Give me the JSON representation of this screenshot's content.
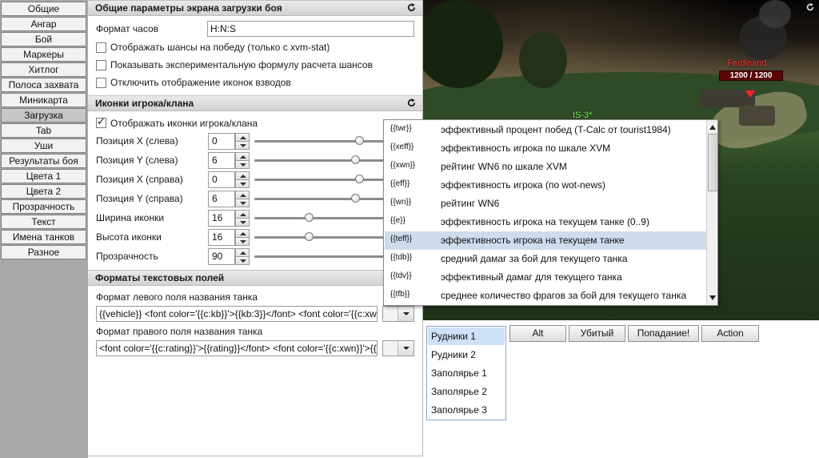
{
  "tabs": [
    "Общие",
    "Ангар",
    "Бой",
    "Маркеры",
    "Хитлог",
    "Полоса захвата",
    "Миникарта",
    "Загрузка",
    "Tab",
    "Уши",
    "Результаты боя",
    "Цвета 1",
    "Цвета 2",
    "Прозрачность",
    "Текст",
    "Имена танков",
    "Разное"
  ],
  "active_tab": "Загрузка",
  "section1": {
    "title": "Общие параметры экрана загрузки боя",
    "clock_label": "Формат часов",
    "clock_value": "H:N:S",
    "checks": [
      {
        "label": "Отображать шансы на победу (только с xvm-stat)",
        "checked": false
      },
      {
        "label": "Показывать экспериментальную формулу расчета шансов",
        "checked": false
      },
      {
        "label": "Отключить отображение иконок взводов",
        "checked": false
      }
    ]
  },
  "section2": {
    "title": "Иконки игрока/клана",
    "check_label": "Отображать иконки игрока/клана",
    "check_on": true,
    "rows": [
      {
        "label": "Позиция X (слева)",
        "value": "0",
        "level": 0.5
      },
      {
        "label": "Позиция Y (слева)",
        "value": "6",
        "level": 0.48
      },
      {
        "label": "Позиция X (справа)",
        "value": "0",
        "level": 0.5
      },
      {
        "label": "Позиция Y (справа)",
        "value": "6",
        "level": 0.48
      },
      {
        "label": "Ширина иконки",
        "value": "16",
        "level": 0.26
      },
      {
        "label": "Высота иконки",
        "value": "16",
        "level": 0.26
      },
      {
        "label": "Прозрачность",
        "value": "90",
        "level": 0.9
      }
    ]
  },
  "section3": {
    "title": "Форматы текстовых полей",
    "left_label": "Формат левого поля названия танка",
    "left_value": "{{vehicle}} <font color='{{c:kb}}'>{{kb:3}}</font> <font color='{{c:xw",
    "right_label": "Формат правого поля названия танка",
    "right_value": "<font color='{{c:rating}}'>{{rating}}</font> <font color='{{c:xwn}}'>{{"
  },
  "game": {
    "enemy_name": "Ferdinand",
    "enemy_hp": "1200 / 1200",
    "ally_name": "IS-3*"
  },
  "macro_list": [
    {
      "code": "{{twr}}",
      "desc": "эффективный процент побед (T-Calc от tourist1984)"
    },
    {
      "code": "{{xeff}}",
      "desc": "эффективность игрока по шкале XVM"
    },
    {
      "code": "{{xwn}}",
      "desc": "рейтинг WN6 по шкале XVM"
    },
    {
      "code": "{{eff}}",
      "desc": "эффективность игрока (по wot-news)"
    },
    {
      "code": "{{wn}}",
      "desc": "рейтинг WN6"
    },
    {
      "code": "{{e}}",
      "desc": "эффективность игрока на текущем танке (0..9)"
    },
    {
      "code": "{{teff}}",
      "desc": "эффективность игрока на текущем танке"
    },
    {
      "code": "{{tdb}}",
      "desc": "средний дамаг за бой для текущего танка"
    },
    {
      "code": "{{tdv}}",
      "desc": "эффективный дамаг для текущего танка"
    },
    {
      "code": "{{tfb}}",
      "desc": "среднее количество фрагов за бой для текущего танка"
    }
  ],
  "macro_selected": 6,
  "maps": [
    "Рудники 1",
    "Рудники 2",
    "Заполярье 1",
    "Заполярье 2",
    "Заполярье 3"
  ],
  "map_selected": 0,
  "buttons": {
    "alt": "Alt",
    "dead": "Убитый",
    "hit": "Попадание!",
    "action": "Action"
  }
}
